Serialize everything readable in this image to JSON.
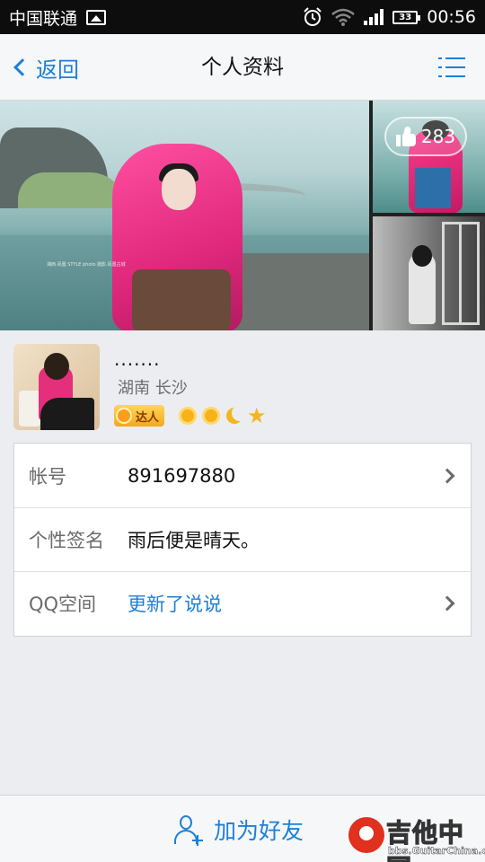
{
  "status_bar": {
    "carrier": "中国联通",
    "time": "00:56",
    "battery": "33",
    "icons": [
      "image-icon",
      "alarm-icon",
      "wifi-icon",
      "signal-icon",
      "battery-icon"
    ]
  },
  "header": {
    "back_label": "返回",
    "title": "个人资料",
    "menu_icon": "list-menu-icon"
  },
  "gallery": {
    "likes": "283",
    "photo_count": 3,
    "main_photo_caption": "湘西·凤凰 STYLE photo 摄影·凤凰古城"
  },
  "profile": {
    "nickname": ".......",
    "location": "湖南 长沙",
    "badge_label": "达人",
    "level_icons": [
      "sun-icon",
      "sun-icon",
      "moon-icon",
      "star-icon"
    ]
  },
  "info": {
    "rows": [
      {
        "label": "帐号",
        "value": "891697880",
        "has_arrow": true
      },
      {
        "label": "个性签名",
        "value": "雨后便是晴天。",
        "has_arrow": false
      },
      {
        "label": "QQ空间",
        "value": "更新了说说",
        "has_arrow": true
      }
    ]
  },
  "footer": {
    "add_friend_label": "加为好友"
  },
  "watermark": {
    "title": "吉他中国",
    "subtitle": "bbs.GuitarChina.com"
  },
  "colors": {
    "accent": "#1e7fd6",
    "background": "#ecedf0",
    "nav_background": "#f6f7f9"
  }
}
